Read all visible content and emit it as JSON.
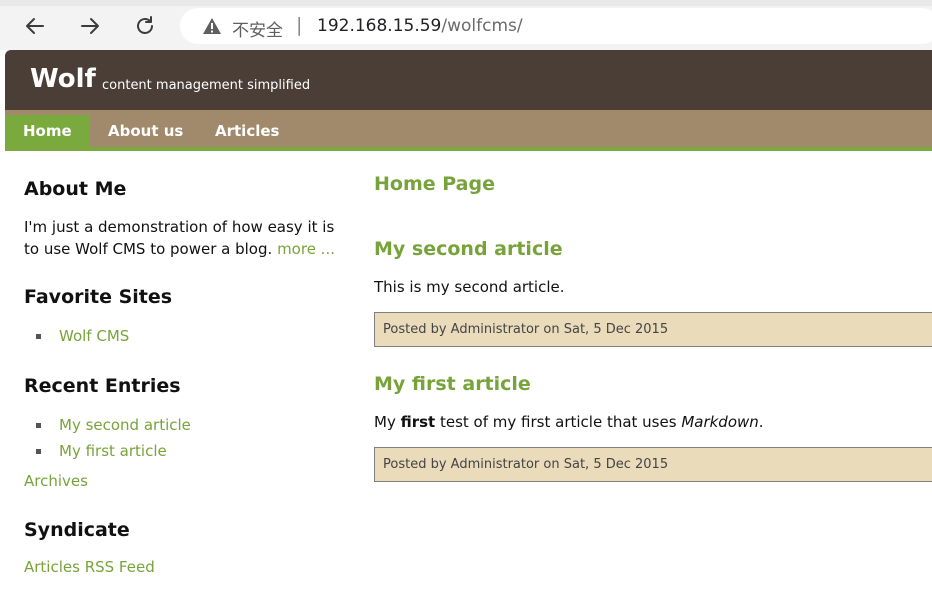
{
  "browser": {
    "insecure_label": "不安全",
    "separator": "|",
    "url_host": "192.168.15.59",
    "url_path": "/wolfcms/"
  },
  "site": {
    "logo": "Wolf",
    "slogan": "content management simplified"
  },
  "nav": {
    "items": [
      {
        "label": "Home",
        "current": true
      },
      {
        "label": "About us"
      },
      {
        "label": "Articles"
      }
    ]
  },
  "sidebar": {
    "about_title": "About Me",
    "about_text_line1": "I'm just a demonstration of how easy it is",
    "about_text_line2": "to use Wolf CMS to power a blog.",
    "about_more": "more ...",
    "favorites_title": "Favorite Sites",
    "favorites": [
      "Wolf CMS"
    ],
    "recent_title": "Recent Entries",
    "recent": [
      "My second article",
      "My first article"
    ],
    "archives_link": "Archives",
    "syndicate_title": "Syndicate",
    "rss_link": "Articles RSS Feed"
  },
  "content": {
    "page_title": "Home Page",
    "articles": [
      {
        "title": "My second article",
        "body": "This is my second article.",
        "info": "Posted by Administrator on Sat, 5 Dec 2015"
      },
      {
        "title": "My first article",
        "body_prefix": "My ",
        "body_bold": "first",
        "body_middle": " test of my first article that uses ",
        "body_italic": "Markdown",
        "body_suffix": ".",
        "info": "Posted by Administrator on Sat, 5 Dec 2015"
      }
    ]
  },
  "colors": {
    "header_bg": "#4a3e37",
    "nav_bg": "#a1896b",
    "accent_green": "#7aa93e",
    "info_bg": "#eadbbb"
  }
}
